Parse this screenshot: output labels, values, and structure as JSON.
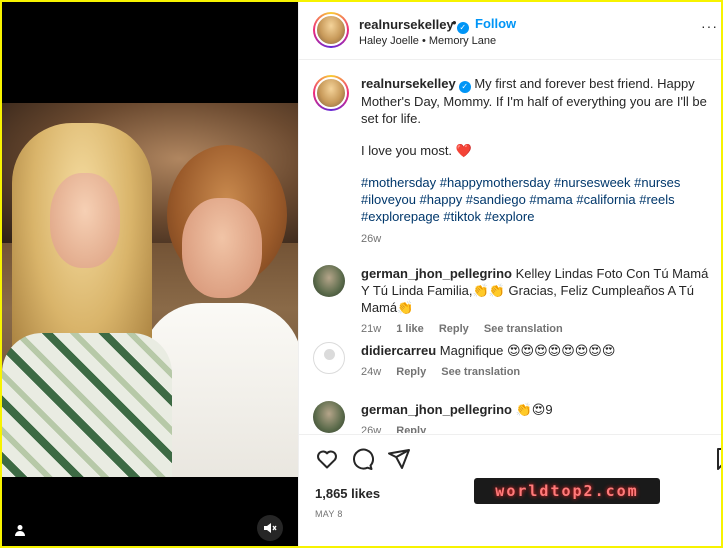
{
  "post": {
    "username": "realnursekelley",
    "follow_label": "Follow",
    "separator": "•",
    "subtitle": "Haley Joelle • Memory Lane",
    "more_label": "···"
  },
  "caption": {
    "username": "realnursekelley",
    "text": "My first and forever best friend. Happy Mother's Day, Mommy. If I'm half of everything you are I'll be set for life.",
    "line2": "I love you most. ❤️",
    "hashtags": "#mothersday #happymothersday #nursesweek #nurses #iloveyou #happy #sandiego #mama #california #reels #explorepage #tiktok #explore",
    "age": "26w"
  },
  "comments": [
    {
      "username": "german_jhon_pellegrino",
      "text": "Kelley Lindas Foto Con Tú Mamá Y Tú Linda Familia,👏👏 Gracias, Feliz Cumpleaños A Tú Mamá👏",
      "age": "21w",
      "likes": "1 like",
      "reply": "Reply",
      "translate": "See translation"
    },
    {
      "username": "didiercarreu",
      "text": "Magnifique 😍😍😍😍😍😍😍😍",
      "age": "24w",
      "reply": "Reply",
      "translate": "See translation"
    },
    {
      "username": "german_jhon_pellegrino",
      "text": "👏😍9",
      "age": "26w",
      "reply": "Reply"
    }
  ],
  "actions": {
    "likes": "1,865 likes",
    "date": "MAY 8"
  },
  "icons": {
    "like": "heart-icon",
    "comment": "comment-icon",
    "share": "share-icon",
    "save": "bookmark-icon",
    "mute": "muted-speaker-icon",
    "tag": "user-tag-icon"
  },
  "watermark": "worldtop2.com",
  "colors": {
    "link": "#0095f6",
    "hashtag": "#00376b",
    "border_yellow": "#f7f300"
  }
}
